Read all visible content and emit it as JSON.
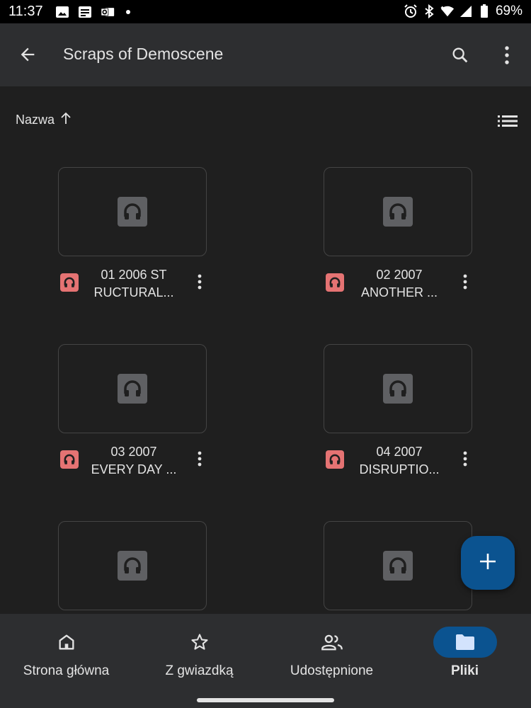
{
  "status_bar": {
    "time": "11:37",
    "battery": "69%",
    "left_icons": [
      "image-notification-icon",
      "message-notification-icon",
      "outlook-notification-icon",
      "more-notifications-dot"
    ],
    "right_icons": [
      "alarm-icon",
      "bluetooth-icon",
      "wifi-icon",
      "signal-icon",
      "battery-icon"
    ]
  },
  "app_bar": {
    "title": "Scraps of Demoscene",
    "icons": [
      "back-arrow-icon",
      "search-icon",
      "more-vert-icon"
    ]
  },
  "sort": {
    "label": "Nazwa",
    "direction_icon": "arrow-up-icon",
    "view_icon": "list-view-icon"
  },
  "files": [
    {
      "name_line1": "01 2006 ST",
      "name_line2": "RUCTURAL...",
      "type_icon": "audio-file-icon"
    },
    {
      "name_line1": "02 2007",
      "name_line2": "ANOTHER ...",
      "type_icon": "audio-file-icon"
    },
    {
      "name_line1": "03 2007",
      "name_line2": "EVERY DAY ...",
      "type_icon": "audio-file-icon"
    },
    {
      "name_line1": "04 2007",
      "name_line2": "DISRUPTIO...",
      "type_icon": "audio-file-icon"
    },
    {
      "name_line1": "",
      "name_line2": "",
      "type_icon": "audio-file-icon"
    },
    {
      "name_line1": "",
      "name_line2": "",
      "type_icon": "audio-file-icon"
    }
  ],
  "fab": {
    "icon": "plus-icon"
  },
  "bottom_nav": [
    {
      "label": "Strona główna",
      "icon": "home-icon",
      "active": false
    },
    {
      "label": "Z gwiazdką",
      "icon": "star-icon",
      "active": false
    },
    {
      "label": "Udostępnione",
      "icon": "people-icon",
      "active": false
    },
    {
      "label": "Pliki",
      "icon": "folder-icon",
      "active": true
    }
  ],
  "colors": {
    "background": "#1f1f1f",
    "app_bar": "#2d2e30",
    "accent": "#0b5390",
    "audio_file_icon": "#e57373",
    "text": "#e3e3e3"
  }
}
